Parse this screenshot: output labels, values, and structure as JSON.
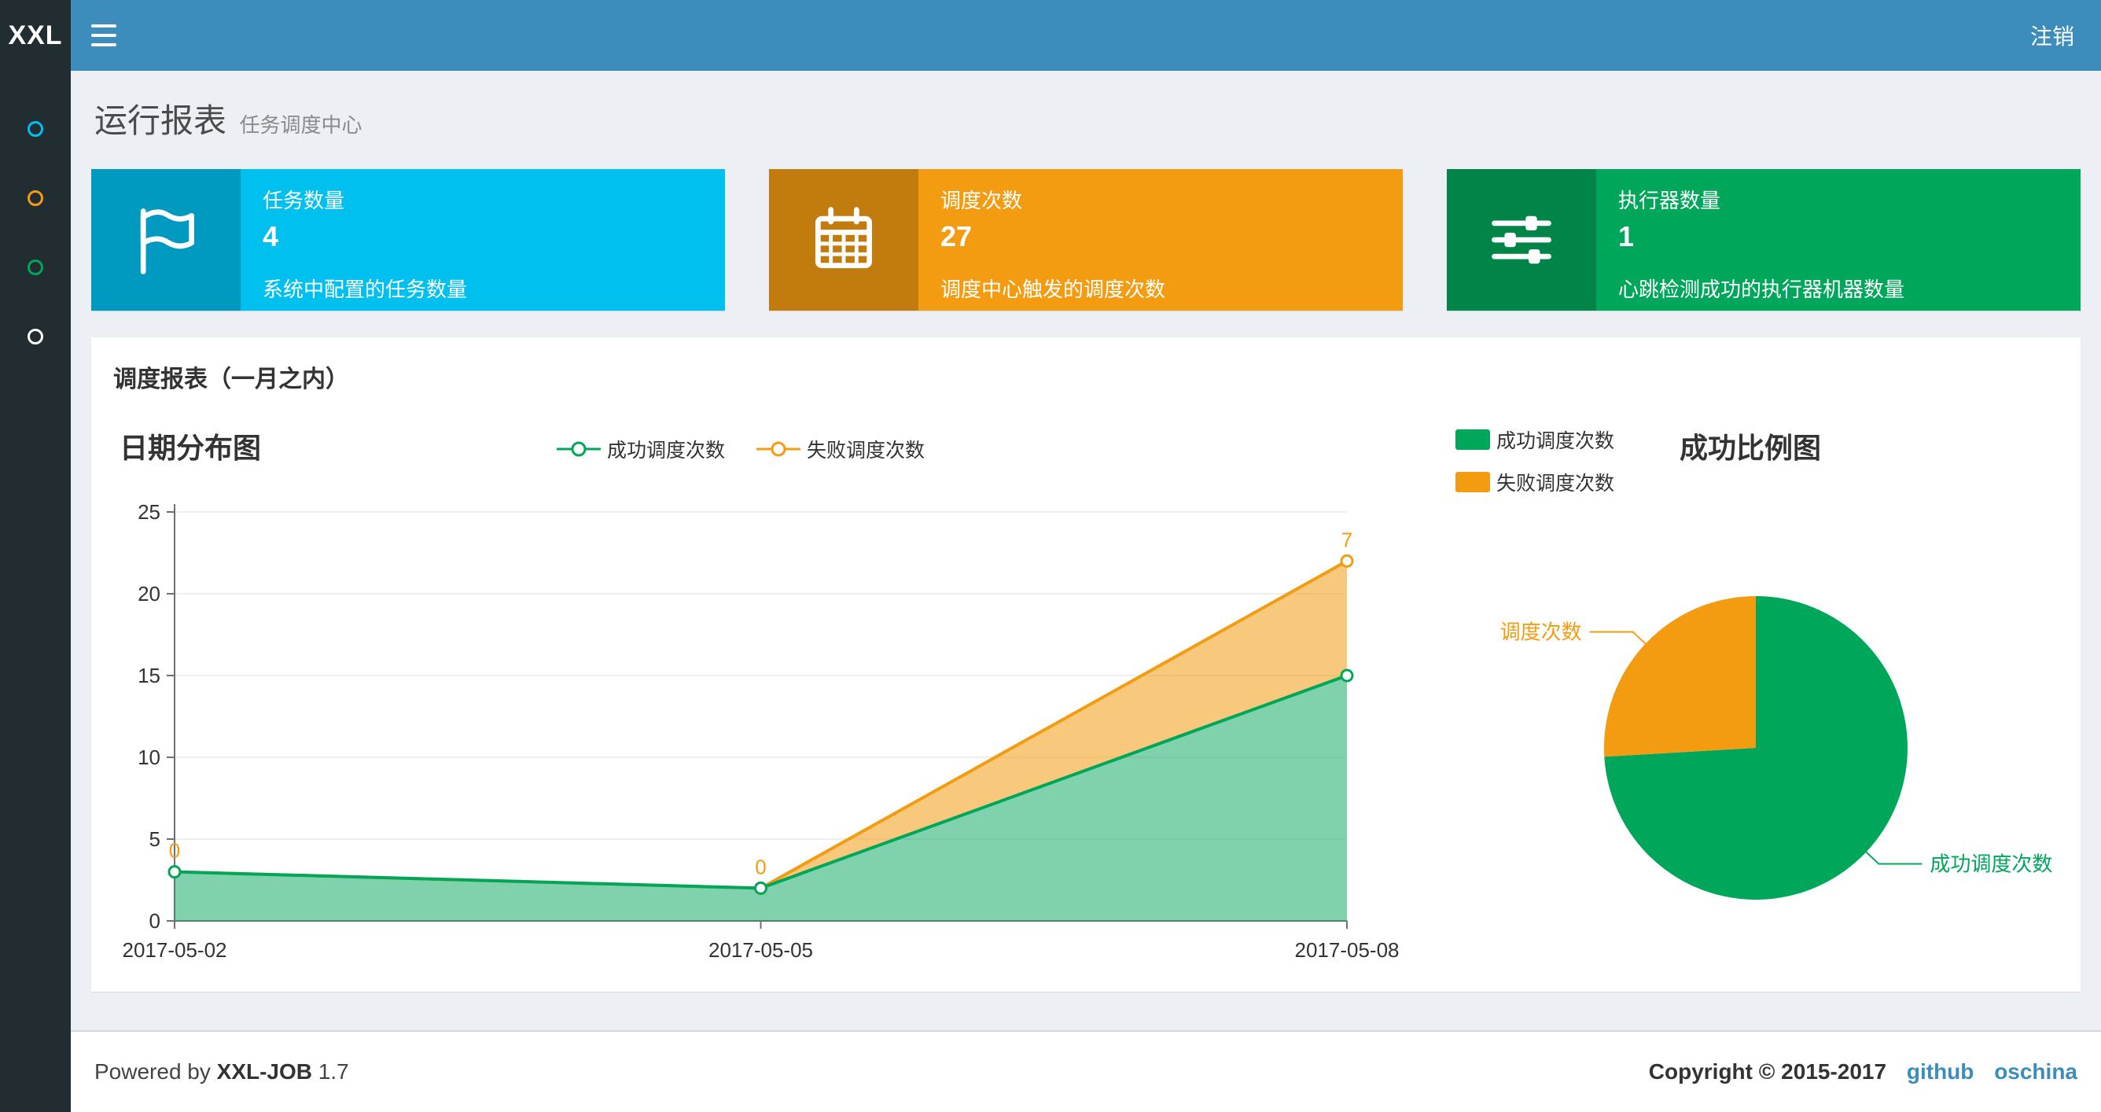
{
  "navbar": {
    "logo": "XXL",
    "logout": "注销"
  },
  "sidebar": {
    "items": [
      {
        "icon": "circle-outline-icon",
        "color": "#00c0ef"
      },
      {
        "icon": "circle-outline-icon",
        "color": "#f39c12"
      },
      {
        "icon": "circle-outline-icon",
        "color": "#00a65a"
      },
      {
        "icon": "circle-outline-icon",
        "color": "#ffffff"
      }
    ]
  },
  "header": {
    "title": "运行报表",
    "subtitle": "任务调度中心"
  },
  "info_boxes": [
    {
      "icon": "flag-icon",
      "title": "任务数量",
      "value": "4",
      "desc": "系统中配置的任务数量",
      "color": "#00c0ef"
    },
    {
      "icon": "calendar-icon",
      "title": "调度次数",
      "value": "27",
      "desc": "调度中心触发的调度次数",
      "color": "#f39c12"
    },
    {
      "icon": "sliders-icon",
      "title": "执行器数量",
      "value": "1",
      "desc": "心跳检测成功的执行器机器数量",
      "color": "#00a65a"
    }
  ],
  "panel": {
    "title": "调度报表（一月之内）"
  },
  "chart_data": [
    {
      "type": "area",
      "title": "日期分布图",
      "x": [
        "2017-05-02",
        "2017-05-05",
        "2017-05-08"
      ],
      "series": [
        {
          "name": "成功调度次数",
          "values": [
            3,
            2,
            15
          ],
          "color": "#00a65a"
        },
        {
          "name": "失败调度次数",
          "values": [
            0,
            0,
            7
          ],
          "color": "#f39c12",
          "labels": [
            "0",
            "0",
            "7"
          ]
        }
      ],
      "stacked": true,
      "ylim": [
        0,
        25
      ],
      "yticks": [
        0,
        5,
        10,
        15,
        20,
        25
      ],
      "grid": true,
      "legend_position": "top"
    },
    {
      "type": "pie",
      "title": "成功比例图",
      "slices": [
        {
          "name": "成功调度次数",
          "value": 20,
          "color": "#00a65a"
        },
        {
          "name": "失败调度次数",
          "value": 7,
          "color": "#f39c12"
        }
      ],
      "legend_position": "top-left"
    }
  ],
  "footer": {
    "powered_prefix": "Powered by",
    "product": "XXL-JOB",
    "version": "1.7",
    "copyright": "Copyright © 2015-2017",
    "links": [
      "github",
      "oschina"
    ]
  }
}
